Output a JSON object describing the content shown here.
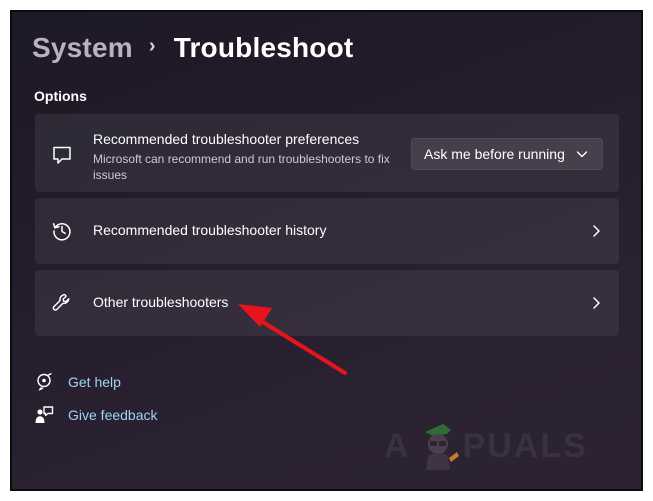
{
  "breadcrumb": {
    "parent": "System",
    "separator": "›",
    "current": "Troubleshoot"
  },
  "section": {
    "label": "Options"
  },
  "options": [
    {
      "icon": "chat-bubble-icon",
      "title": "Recommended troubleshooter preferences",
      "description": "Microsoft can recommend and run troubleshooters to fix issues",
      "dropdown": {
        "value": "Ask me before running",
        "icon": "chevron-down-icon"
      }
    },
    {
      "icon": "history-icon",
      "title": "Recommended troubleshooter history",
      "arrow_icon": "chevron-right-icon"
    },
    {
      "icon": "wrench-icon",
      "title": "Other troubleshooters",
      "arrow_icon": "chevron-right-icon"
    }
  ],
  "links": [
    {
      "icon": "help-icon",
      "label": "Get help"
    },
    {
      "icon": "feedback-icon",
      "label": "Give feedback"
    }
  ],
  "watermark": {
    "left": "A",
    "right": "PUALS"
  },
  "annotation": {
    "icon": "red-arrow-icon",
    "color": "#e8141c"
  },
  "colors": {
    "background": "#231c2b",
    "card": "#2f2a35",
    "link": "#9fd3f5",
    "text": "#ffffff"
  }
}
